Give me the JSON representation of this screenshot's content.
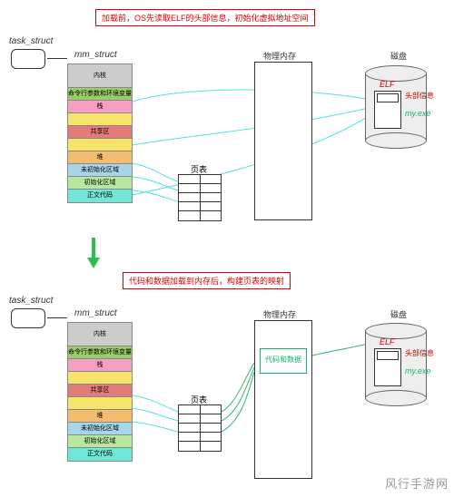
{
  "captions": {
    "top": "加载前，OS先读取ELF的头部信息，初始化虚拟地址空间",
    "mid": "代码和数据加载到内存后，构建页表的映射"
  },
  "labels": {
    "task_struct": "task_struct",
    "mm_struct": "mm_struct",
    "page_table": "页表",
    "phys_mem": "物理内存",
    "disk": "磁盘",
    "elf": "ELF",
    "head_info": "头部信息",
    "myexe": "my.exe",
    "code_data": "代码和数据"
  },
  "mm_rows": [
    {
      "text": "内核",
      "cls": "c-gray"
    },
    {
      "text": "命令行参数和环境变量",
      "cls": "c-green"
    },
    {
      "text": "栈",
      "cls": "c-pink"
    },
    {
      "text": "",
      "cls": "c-yel"
    },
    {
      "text": "共享区",
      "cls": "c-red"
    },
    {
      "text": "",
      "cls": "c-yel"
    },
    {
      "text": "堆",
      "cls": "c-ora"
    },
    {
      "text": "未初始化区域",
      "cls": "c-blue"
    },
    {
      "text": "初始化区域",
      "cls": "c-lgreen"
    },
    {
      "text": "正文代码",
      "cls": "c-aqua"
    }
  ],
  "watermark": "风行手游网"
}
